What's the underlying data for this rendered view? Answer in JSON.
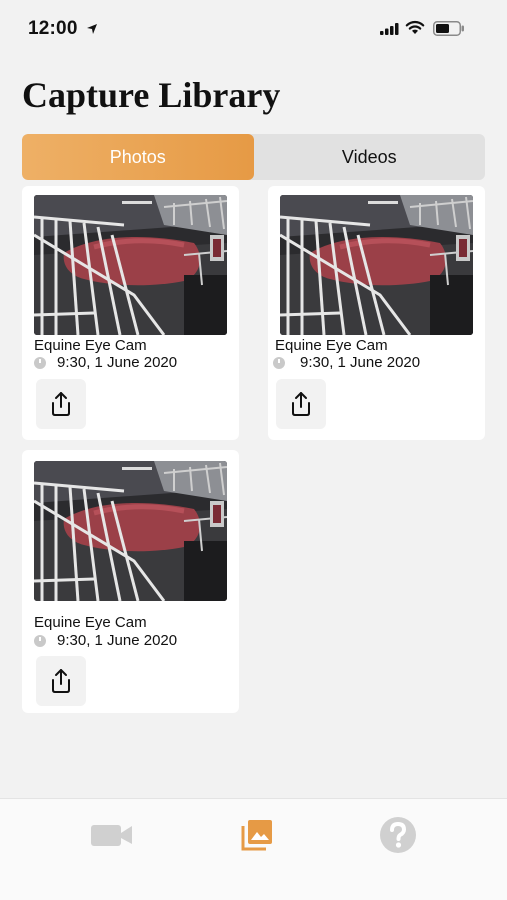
{
  "status_bar": {
    "time": "12:00",
    "icons": [
      "location-arrow-icon",
      "cellular-signal-icon",
      "wifi-icon",
      "battery-icon"
    ]
  },
  "header": {
    "title": "Capture Library"
  },
  "segments": {
    "photos_label": "Photos",
    "videos_label": "Videos",
    "selected": "Photos"
  },
  "captures": [
    {
      "camera": "Equine Eye Cam",
      "timestamp": "9:30, 1 June 2020"
    },
    {
      "camera": "Equine Eye Cam",
      "timestamp": "9:30, 1 June 2020"
    },
    {
      "camera": "Equine Eye Cam",
      "timestamp": "9:30, 1 June 2020"
    }
  ],
  "tab_bar": {
    "tabs": [
      {
        "icon": "video-camera-icon",
        "active": false
      },
      {
        "icon": "photo-library-icon",
        "active": true
      },
      {
        "icon": "help-icon",
        "active": false
      }
    ]
  },
  "colors": {
    "accent": "#e69a45",
    "accent_light": "#eeb066",
    "background": "#f2f2f2",
    "card": "#ffffff",
    "inactive_icon": "#d0d0d0"
  }
}
